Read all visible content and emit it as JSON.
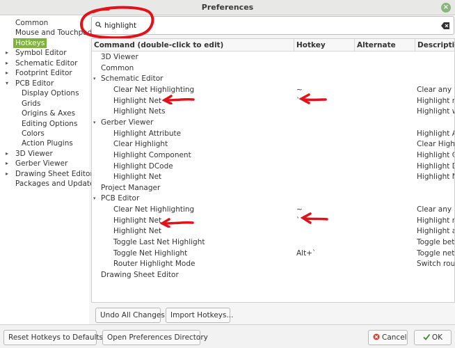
{
  "window": {
    "title": "Preferences"
  },
  "sidebar": {
    "items": [
      {
        "label": "Common",
        "indent": 0,
        "expandable": false,
        "selected": false
      },
      {
        "label": "Mouse and Touchpad",
        "indent": 0,
        "expandable": false,
        "selected": false
      },
      {
        "label": "Hotkeys",
        "indent": 0,
        "expandable": false,
        "selected": true
      },
      {
        "label": "Symbol Editor",
        "indent": 0,
        "expandable": true,
        "selected": false
      },
      {
        "label": "Schematic Editor",
        "indent": 0,
        "expandable": true,
        "selected": false
      },
      {
        "label": "Footprint Editor",
        "indent": 0,
        "expandable": true,
        "selected": false
      },
      {
        "label": "PCB Editor",
        "indent": 0,
        "expandable": true,
        "expanded": true,
        "selected": false
      },
      {
        "label": "Display Options",
        "indent": 1,
        "expandable": false,
        "selected": false
      },
      {
        "label": "Grids",
        "indent": 1,
        "expandable": false,
        "selected": false
      },
      {
        "label": "Origins & Axes",
        "indent": 1,
        "expandable": false,
        "selected": false
      },
      {
        "label": "Editing Options",
        "indent": 1,
        "expandable": false,
        "selected": false
      },
      {
        "label": "Colors",
        "indent": 1,
        "expandable": false,
        "selected": false
      },
      {
        "label": "Action Plugins",
        "indent": 1,
        "expandable": false,
        "selected": false
      },
      {
        "label": "3D Viewer",
        "indent": 0,
        "expandable": true,
        "selected": false
      },
      {
        "label": "Gerber Viewer",
        "indent": 0,
        "expandable": true,
        "selected": false
      },
      {
        "label": "Drawing Sheet Editor",
        "indent": 0,
        "expandable": true,
        "selected": false
      },
      {
        "label": "Packages and Updates",
        "indent": 0,
        "expandable": false,
        "selected": false
      }
    ]
  },
  "search": {
    "value": "highlight",
    "placeholder": ""
  },
  "table": {
    "columns": [
      "Command (double-click to edit)",
      "Hotkey",
      "Alternate",
      "Description"
    ],
    "rows": [
      {
        "level": 0,
        "command": "3D Viewer",
        "hotkey": "",
        "alternate": "",
        "description": ""
      },
      {
        "level": 0,
        "command": "Common",
        "hotkey": "",
        "alternate": "",
        "description": ""
      },
      {
        "level": 0,
        "expander": "open",
        "command": "Schematic Editor",
        "hotkey": "",
        "alternate": "",
        "description": ""
      },
      {
        "level": 1,
        "command": "Clear Net Highlighting",
        "hotkey": "~",
        "alternate": "",
        "description": "Clear any ex"
      },
      {
        "level": 1,
        "command": "Highlight Net",
        "hotkey": "`",
        "alternate": "",
        "description": "Highlight net"
      },
      {
        "level": 1,
        "command": "Highlight Nets",
        "hotkey": "",
        "alternate": "",
        "description": "Highlight wi"
      },
      {
        "level": 0,
        "expander": "open",
        "command": "Gerber Viewer",
        "hotkey": "",
        "alternate": "",
        "description": ""
      },
      {
        "level": 1,
        "command": "Highlight Attribute",
        "hotkey": "",
        "alternate": "",
        "description": "Highlight At"
      },
      {
        "level": 1,
        "command": "Clear Highlight",
        "hotkey": "",
        "alternate": "",
        "description": "Clear Highlig"
      },
      {
        "level": 1,
        "command": "Highlight Component",
        "hotkey": "",
        "alternate": "",
        "description": "Highlight Co"
      },
      {
        "level": 1,
        "command": "Highlight DCode",
        "hotkey": "",
        "alternate": "",
        "description": "Highlight DC"
      },
      {
        "level": 1,
        "command": "Highlight Net",
        "hotkey": "",
        "alternate": "",
        "description": "Highlight Ne"
      },
      {
        "level": 0,
        "command": "Project Manager",
        "hotkey": "",
        "alternate": "",
        "description": ""
      },
      {
        "level": 0,
        "expander": "open",
        "command": "PCB Editor",
        "hotkey": "",
        "alternate": "",
        "description": ""
      },
      {
        "level": 1,
        "command": "Clear Net Highlighting",
        "hotkey": "~",
        "alternate": "",
        "description": "Clear any ex"
      },
      {
        "level": 1,
        "command": "Highlight Net",
        "hotkey": "`",
        "alternate": "",
        "description": "Highlight net"
      },
      {
        "level": 1,
        "command": "Highlight Net",
        "hotkey": "",
        "alternate": "",
        "description": "Highlight all"
      },
      {
        "level": 1,
        "command": "Toggle Last Net Highlight",
        "hotkey": "",
        "alternate": "",
        "description": "Toggle betw"
      },
      {
        "level": 1,
        "command": "Toggle Net Highlight",
        "hotkey": "Alt+`",
        "alternate": "",
        "description": "Toggle net h"
      },
      {
        "level": 1,
        "command": "Router Highlight Mode",
        "hotkey": "",
        "alternate": "",
        "description": "Switch route"
      },
      {
        "level": 0,
        "command": "Drawing Sheet Editor",
        "hotkey": "",
        "alternate": "",
        "description": ""
      }
    ]
  },
  "buttons": {
    "undo_all": "Undo All Changes",
    "import_hotkeys": "Import Hotkeys...",
    "reset_hotkeys": "Reset Hotkeys to Defaults",
    "open_prefs_dir": "Open Preferences Directory",
    "cancel": "Cancel",
    "ok": "OK"
  },
  "colors": {
    "selection": "#7fb13e",
    "annotation_red": "#e0121a",
    "cancel_icon": "#d63a2a",
    "ok_icon": "#3a8a2a",
    "close_button": "#8ab57a"
  },
  "icons": {
    "search": "search-icon",
    "clear": "clear-search-icon",
    "close": "close-icon",
    "cancel": "cancel-icon",
    "ok": "checkmark-icon"
  }
}
